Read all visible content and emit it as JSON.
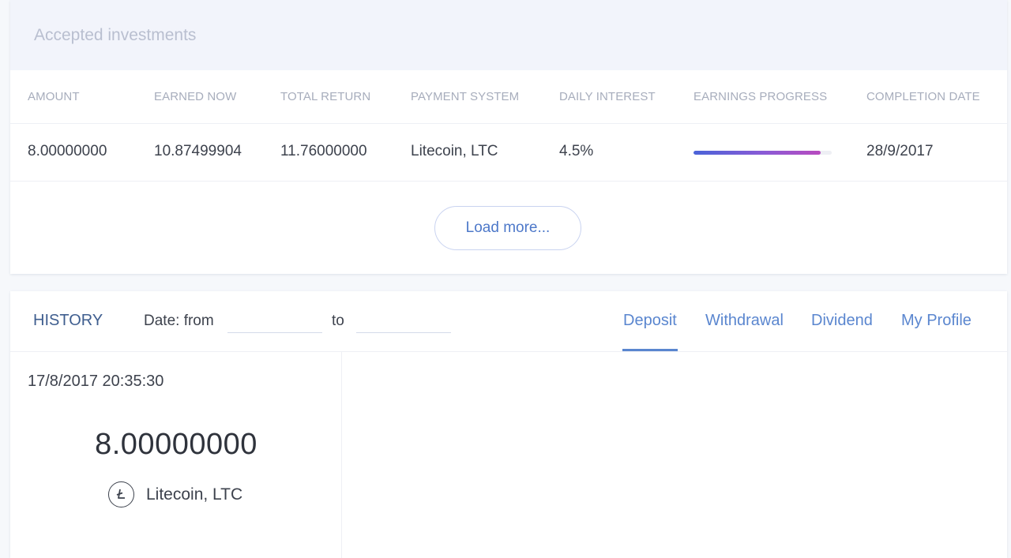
{
  "investments": {
    "title": "Accepted investments",
    "columns": [
      "AMOUNT",
      "EARNED NOW",
      "TOTAL RETURN",
      "PAYMENT SYSTEM",
      "DAILY INTEREST",
      "EARNINGS PROGRESS",
      "COMPLETION DATE"
    ],
    "rows": [
      {
        "amount": "8.00000000",
        "earned_now": "10.87499904",
        "total_return": "11.76000000",
        "payment_system": "Litecoin, LTC",
        "daily_interest": "4.5%",
        "earnings_progress": 0.92,
        "completion_date": "28/9/2017"
      }
    ],
    "load_more_label": "Load more..."
  },
  "history": {
    "title": "HISTORY",
    "date_from_label": "Date: from",
    "date_to_label": "to",
    "date_from_value": "",
    "date_to_value": "",
    "tabs": [
      {
        "label": "Deposit",
        "active": true
      },
      {
        "label": "Withdrawal",
        "active": false
      },
      {
        "label": "Dividend",
        "active": false
      },
      {
        "label": "My Profile",
        "active": false
      }
    ],
    "items": [
      {
        "datetime": "17/8/2017 20:35:30",
        "amount": "8.00000000",
        "payment_system": "Litecoin, LTC",
        "icon": "litecoin-icon"
      }
    ]
  },
  "colors": {
    "accent": "#5a86cf",
    "progress_start": "#4a63d8",
    "progress_end": "#b84bbf"
  }
}
